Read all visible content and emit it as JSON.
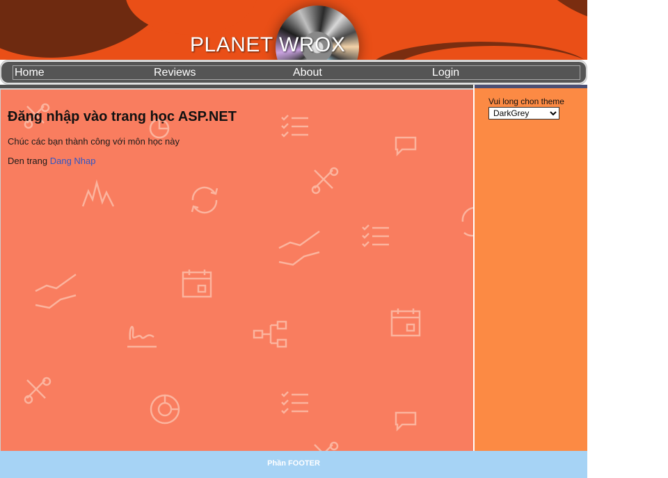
{
  "header": {
    "site_title": "PLANET WROX",
    "brand_color": "#ea4f17"
  },
  "menu": {
    "items": [
      {
        "label": "Home"
      },
      {
        "label": "Reviews"
      },
      {
        "label": "About"
      },
      {
        "label": "Login"
      }
    ]
  },
  "main": {
    "heading": "Đăng nhập vào trang học ASP.NET",
    "welcome_text": "Chúc các bạn thành công với môn học này",
    "login_prefix": "Den trang",
    "login_link": "Dang Nhap",
    "background_color": "#f97d5f",
    "decorative_icons": [
      "tools-icon",
      "checklist-icon",
      "chat-icon",
      "wave-icon",
      "refresh-icon",
      "line-chart-icon",
      "calendar-icon",
      "signature-icon",
      "share-icon",
      "pie-chart-icon"
    ]
  },
  "sidebar": {
    "theme_label": "Vui long chon theme",
    "theme_selected": "DarkGrey",
    "background_color": "#fc8a44"
  },
  "footer": {
    "text": "Phần FOOTER",
    "background_color": "#a6d3f5"
  }
}
